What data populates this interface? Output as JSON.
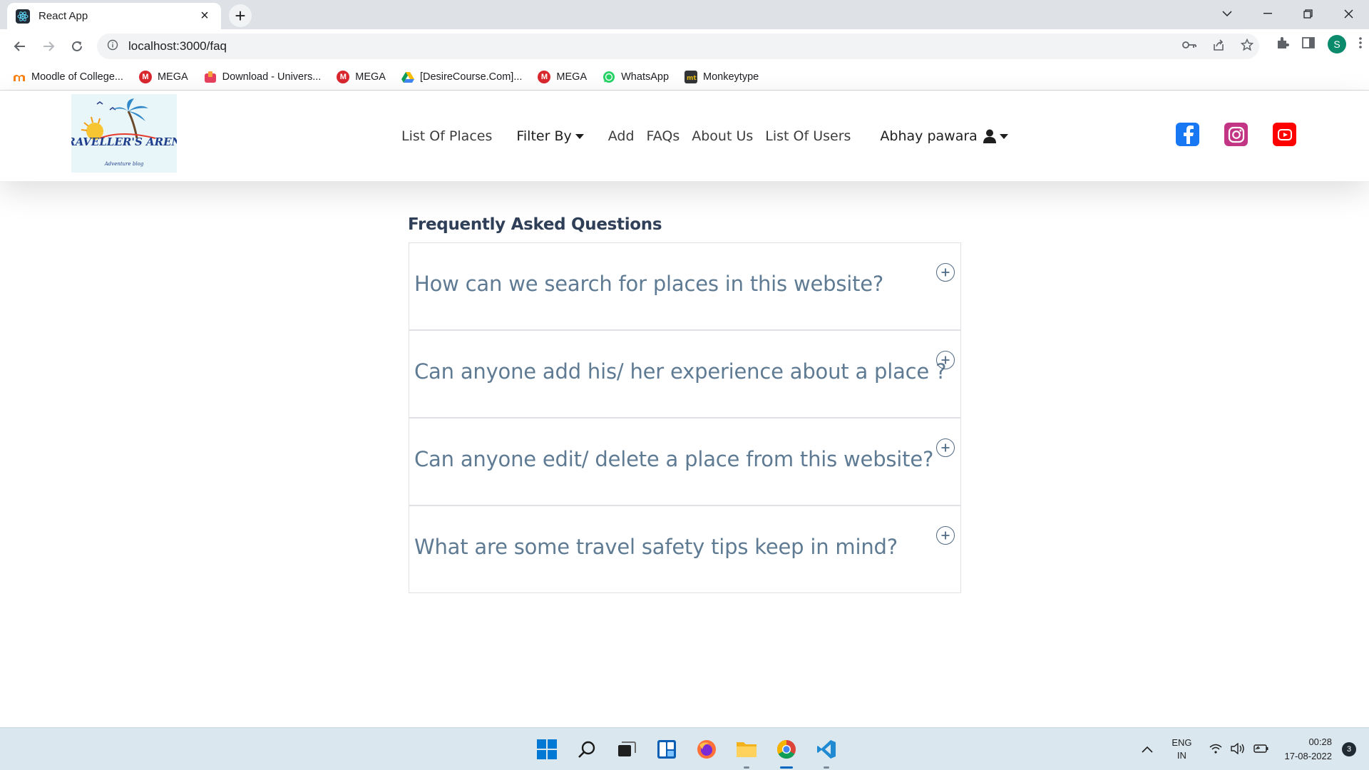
{
  "browser": {
    "tab_title": "React App",
    "url": "localhost:3000/faq",
    "profile_initial": "S",
    "bookmarks": [
      {
        "label": "Moodle of College...",
        "icon": "moodle-icon"
      },
      {
        "label": "MEGA",
        "icon": "mega-icon"
      },
      {
        "label": "Download - Univers...",
        "icon": "download-icon"
      },
      {
        "label": "MEGA",
        "icon": "mega-icon"
      },
      {
        "label": "[DesireCourse.Com]...",
        "icon": "google-drive-icon"
      },
      {
        "label": "MEGA",
        "icon": "mega-icon"
      },
      {
        "label": "WhatsApp",
        "icon": "whatsapp-icon"
      },
      {
        "label": "Monkeytype",
        "icon": "monkeytype-icon"
      }
    ]
  },
  "navbar": {
    "logo_text": "TRAVELLER'S ARENA",
    "logo_tagline": "Adventure blog",
    "links": {
      "list_of_places": "List Of Places",
      "filter_by": "Filter By",
      "add": "Add",
      "faqs": "FAQs",
      "about_us": "About Us",
      "list_of_users": "List Of Users"
    },
    "user_name": "Abhay pawara"
  },
  "faq": {
    "title": "Frequently Asked Questions",
    "questions": [
      "How can we search for places in this website?",
      "Can anyone add his/ her experience about a place ?",
      "Can anyone edit/ delete a place from this website?",
      "What are some travel safety tips keep in mind?"
    ]
  },
  "taskbar": {
    "lang_line1": "ENG",
    "lang_line2": "IN",
    "time": "00:28",
    "date": "17-08-2022",
    "notification_count": "3"
  },
  "colors": {
    "faq_question": "#5f7b93",
    "faq_title": "#2f3f58",
    "facebook": "#1877f2",
    "instagram": "#c13584",
    "youtube": "#ff0000"
  }
}
